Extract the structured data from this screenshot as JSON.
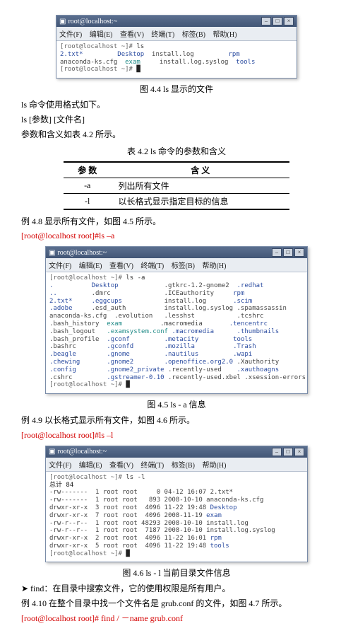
{
  "terminals": {
    "title": "root@localhost:~",
    "menu": [
      "文件(F)",
      "编辑(E)",
      "查看(V)",
      "终端(T)",
      "标签(B)",
      "帮助(H)"
    ],
    "btn_min": "–",
    "btn_max": "□",
    "btn_close": "×",
    "t1": {
      "prompt1": "[root@localhost ~]# ",
      "cmd1": "ls",
      "line_parts": [
        {
          "cls": "blue",
          "t": "2.txt*"
        },
        {
          "cls": "blue",
          "t": "         Desktop"
        },
        {
          "cls": "txt",
          "t": "  install.log         "
        },
        {
          "cls": "blue",
          "t": "rpm"
        }
      ],
      "line2_parts": [
        {
          "cls": "txt",
          "t": "anaconda-ks.cfg  "
        },
        {
          "cls": "teal",
          "t": "exam"
        },
        {
          "cls": "txt",
          "t": "     install.log.syslog  "
        },
        {
          "cls": "blue",
          "t": "tools"
        }
      ],
      "prompt2": "[root@localhost ~]# "
    },
    "t2": {
      "prompt1": "[root@localhost ~]# ",
      "cmd1": "ls -a",
      "rows": [
        [
          {
            "cls": "blue",
            "t": "."
          },
          {
            "cls": "blue",
            "t": "          Desktop"
          },
          {
            "cls": "txt",
            "t": "            .gtkrc-1.2-gnome2  "
          },
          {
            "cls": "blue",
            "t": ".redhat"
          }
        ],
        [
          {
            "cls": "blue",
            "t": ".."
          },
          {
            "cls": "txt",
            "t": "         .dmrc              .ICEauthority     "
          },
          {
            "cls": "blue",
            "t": "rpm"
          }
        ],
        [
          {
            "cls": "blue",
            "t": "2.txt*"
          },
          {
            "cls": "blue",
            "t": "     .eggcups"
          },
          {
            "cls": "txt",
            "t": "           install.log       "
          },
          {
            "cls": "blue",
            "t": ".scim"
          }
        ],
        [
          {
            "cls": "blue",
            "t": ".adobe"
          },
          {
            "cls": "txt",
            "t": "     .esd_auth          install.log.syslog "
          },
          {
            "cls": "txt",
            "t": ".spamassassin"
          }
        ],
        [
          {
            "cls": "txt",
            "t": "anaconda-ks.cfg  .evolution   .lesshst           "
          },
          {
            "cls": "txt",
            "t": ".tcshrc"
          }
        ],
        [
          {
            "cls": "txt",
            "t": ".bash_history  "
          },
          {
            "cls": "teal",
            "t": "exam"
          },
          {
            "cls": "txt",
            "t": "          .macromedia       "
          },
          {
            "cls": "blue",
            "t": ".tencentrc"
          }
        ],
        [
          {
            "cls": "txt",
            "t": ".bash_logout   "
          },
          {
            "cls": "teal",
            "t": ".examsystem.conf"
          },
          {
            "cls": "blue",
            "t": " .macromedia"
          },
          {
            "cls": "blue",
            "t": "      .thumbnails"
          }
        ],
        [
          {
            "cls": "txt",
            "t": ".bash_profile  "
          },
          {
            "cls": "blue",
            "t": ".gconf"
          },
          {
            "cls": "blue",
            "t": "         .metacity"
          },
          {
            "cls": "blue",
            "t": "         tools"
          }
        ],
        [
          {
            "cls": "txt",
            "t": ".bashrc        "
          },
          {
            "cls": "blue",
            "t": ".gconfd"
          },
          {
            "cls": "blue",
            "t": "        .mozilla"
          },
          {
            "cls": "blue",
            "t": "          .Trash"
          }
        ],
        [
          {
            "cls": "blue",
            "t": ".beagle"
          },
          {
            "cls": "blue",
            "t": "        .gnome"
          },
          {
            "cls": "blue",
            "t": "         .nautilus"
          },
          {
            "cls": "blue",
            "t": "         .wapi"
          }
        ],
        [
          {
            "cls": "blue",
            "t": ".chewing"
          },
          {
            "cls": "blue",
            "t": "       .gnome2"
          },
          {
            "cls": "blue",
            "t": "        .openoffice.org2.0"
          },
          {
            "cls": "txt",
            "t": " .Xauthority"
          }
        ],
        [
          {
            "cls": "blue",
            "t": ".config"
          },
          {
            "cls": "blue",
            "t": "        .gnome2_private"
          },
          {
            "cls": "txt",
            "t": " .recently-used    "
          },
          {
            "cls": "blue",
            "t": ".xauthoagns"
          }
        ],
        [
          {
            "cls": "txt",
            "t": ".cshrc         "
          },
          {
            "cls": "blue",
            "t": ".gstreamer-0.10"
          },
          {
            "cls": "txt",
            "t": " .recently-used.xbel "
          },
          {
            "cls": "txt",
            "t": ".xsession-errors"
          }
        ]
      ],
      "prompt2": "[root@localhost ~]# "
    },
    "t3": {
      "prompt1": "[root@localhost ~]# ",
      "cmd1": "ls -l",
      "total": "总计 84",
      "rows": [
        "-rw-------  1 root root     0 04-12 16:07 2.txt*",
        "-rw-------  1 root root   893 2008-10-10 anaconda-ks.cfg",
        "drwxr-xr-x  3 root root  4096 11-22 19:48 Desktop",
        "drwxr-xr-x  7 root root  4096 2008-11-19 exam",
        "-rw-r--r--  1 root root 48293 2008-10-10 install.log",
        "-rw-r--r--  1 root root  7187 2008-10-10 install.log.syslog",
        "drwxr-xr-x  2 root root  4096 11-22 16:01 rpm",
        "drwxr-xr-x  5 root root  4096 11-22 19:48 tools"
      ],
      "prompt2": "[root@localhost ~]# "
    }
  },
  "captions": {
    "c44": "图 4.4 ls 显示的文件",
    "c_tbl": "表 4.2   ls 命令的参数和含义",
    "c45": "图 4.5 ls - a 信息",
    "c46": "图 4.6   ls - l 当前目录文件信息"
  },
  "text": {
    "p1": "ls 命令使用格式如下。",
    "p2": "ls [参数] [文件名]",
    "p3": "参数和含义如表 4.2 所示。",
    "ex48": "例 4.8 显示所有文件，如图 4.5 所示。",
    "cmd48": "[root@localhost root]#ls –a",
    "ex49": "例 4.9 以长格式显示所有文件，如图 4.6 所示。",
    "cmd49": "[root@localhost root]#ls –l",
    "find1": "➤ find：在目录中搜索文件，它的使用权限是所有用户。",
    "find2": "例 4.10 在整个目录中找一个文件名是 grub.conf 的文件，如图 4.7 所示。",
    "find_cmd": "[root@localhost root]# find  /  －name grub.conf"
  },
  "table": {
    "h1": "参   数",
    "h2": "含   义",
    "r1c1": "-a",
    "r1c2": "列出所有文件",
    "r2c1": "-l",
    "r2c2": "以长格式显示指定目标的信息"
  }
}
